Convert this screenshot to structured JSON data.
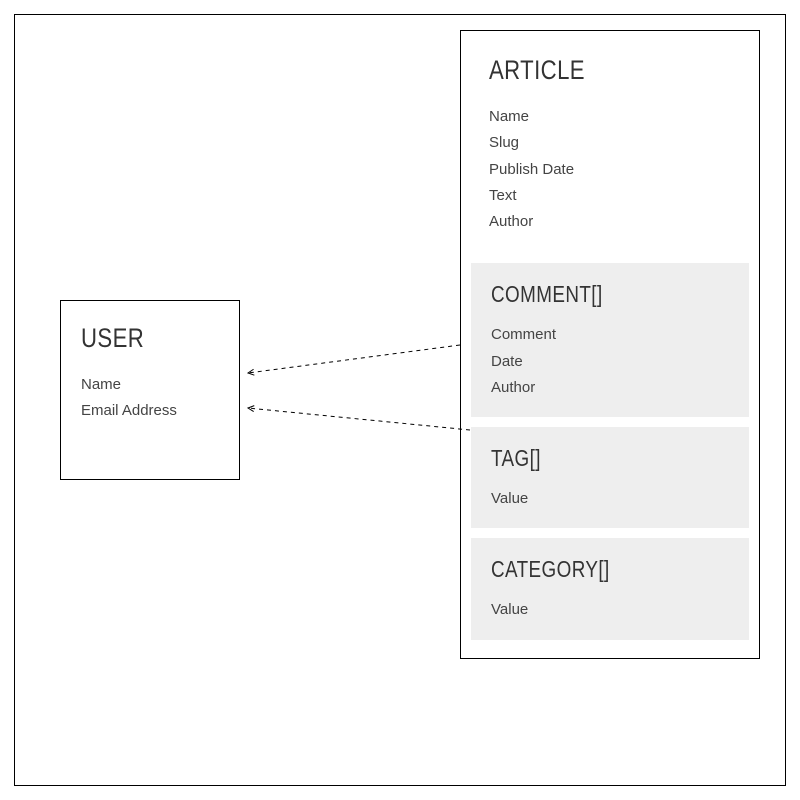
{
  "diagram": {
    "user": {
      "title": "USER",
      "fields": [
        "Name",
        "Email Address"
      ]
    },
    "article": {
      "title": "ARTICLE",
      "fields": [
        "Name",
        "Slug",
        "Publish Date",
        "Text",
        "Author"
      ],
      "children": [
        {
          "title": "COMMENT[]",
          "fields": [
            "Comment",
            "Date",
            "Author"
          ]
        },
        {
          "title": "TAG[]",
          "fields": [
            "Value"
          ]
        },
        {
          "title": "CATEGORY[]",
          "fields": [
            "Value"
          ]
        }
      ]
    }
  },
  "relations": [
    {
      "from": "article.author",
      "to": "user"
    },
    {
      "from": "comment.author",
      "to": "user"
    }
  ]
}
